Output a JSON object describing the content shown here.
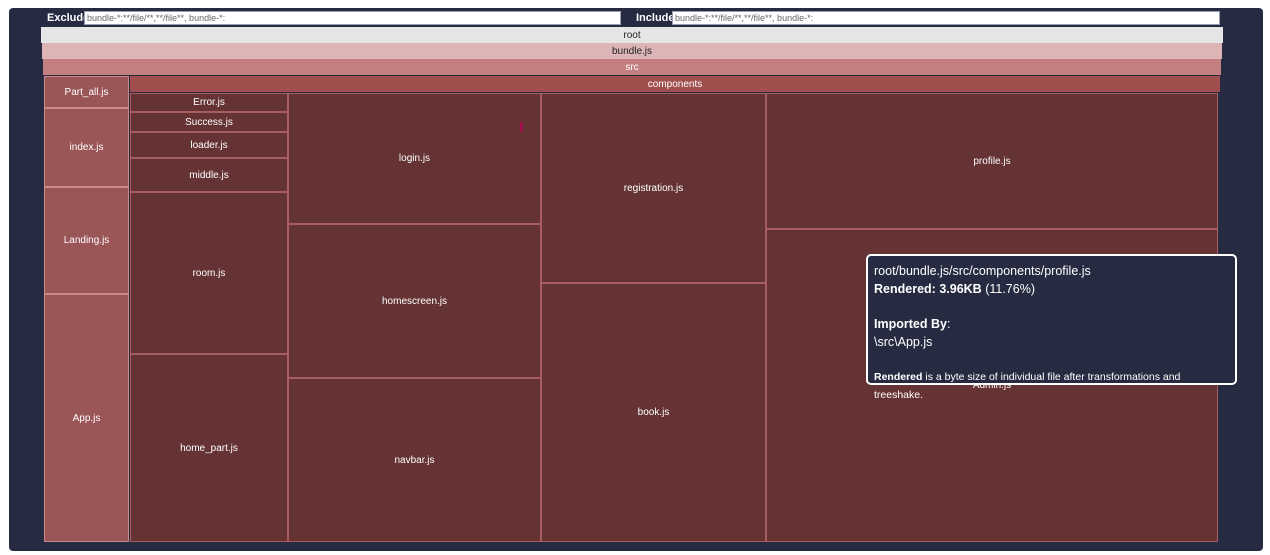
{
  "filters": {
    "exclude_label": "Exclude",
    "exclude_value": "bundle-*:**/file/**,**/file**, bundle-*:",
    "include_label": "Include",
    "include_value": "bundle-*:**/file/**,**/file**, bundle-*:"
  },
  "tree": {
    "root": "root",
    "bundle": "bundle.js",
    "src": "src",
    "components": "components",
    "src_files": [
      "Part_all.js",
      "index.js",
      "Landing.js",
      "App.js"
    ],
    "components_files": [
      "Error.js",
      "Success.js",
      "loader.js",
      "middle.js",
      "room.js",
      "home_part.js",
      "login.js",
      "homescreen.js",
      "navbar.js",
      "registration.js",
      "book.js",
      "profile.js",
      "Admin.js"
    ]
  },
  "tooltip": {
    "path": "root/bundle.js/src/components/profile.js",
    "rendered_label": "Rendered:",
    "rendered_value": "3.96KB",
    "rendered_percent": "(11.76%)",
    "imported_by_label": "Imported By",
    "imported_by_colon": ":",
    "imported_by_value": "\\src\\App.js",
    "note_bold": "Rendered",
    "note_text": " is a byte size of individual file after transformations and treeshake."
  },
  "colors": {
    "background": "#272b41",
    "root": "#e6e6e6",
    "bundle": "#ddb5b6",
    "src": "#c47f80",
    "components": "#a14e4f",
    "leaf": "#653334",
    "selected_marker": "#a0124a"
  }
}
